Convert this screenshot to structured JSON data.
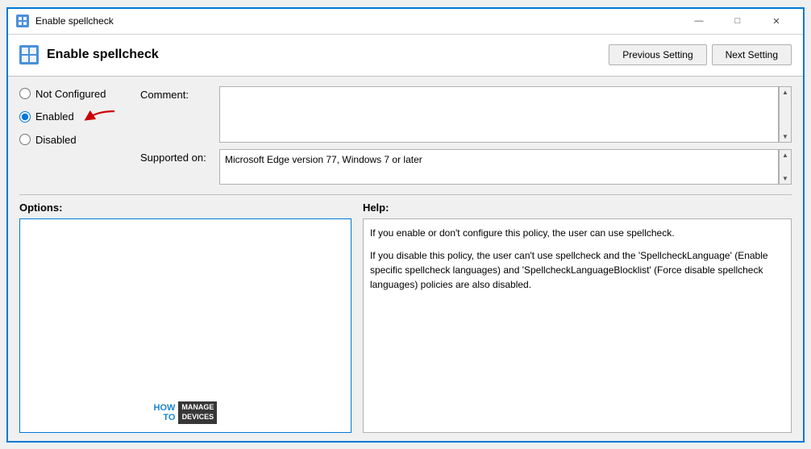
{
  "window": {
    "title": "Enable spellcheck",
    "min_label": "—",
    "max_label": "□",
    "close_label": "✕"
  },
  "header": {
    "title": "Enable spellcheck",
    "prev_btn": "Previous Setting",
    "next_btn": "Next Setting"
  },
  "radio": {
    "not_configured_label": "Not Configured",
    "enabled_label": "Enabled",
    "disabled_label": "Disabled",
    "selected": "enabled"
  },
  "comment": {
    "label": "Comment:",
    "value": ""
  },
  "supported": {
    "label": "Supported on:",
    "value": "Microsoft Edge version 77, Windows 7 or later"
  },
  "options": {
    "title": "Options:"
  },
  "help": {
    "title": "Help:",
    "paragraph1": "If you enable or don't configure this policy, the user can use spellcheck.",
    "paragraph2": "If you disable this policy, the user can't use spellcheck and the 'SpellcheckLanguage' (Enable specific spellcheck languages) and 'SpellcheckLanguageBlocklist' (Force disable spellcheck languages) policies are also disabled."
  },
  "watermark": {
    "how": "HOW",
    "to": "TO",
    "manage": "MANAGE",
    "devices": "DEVICES"
  }
}
